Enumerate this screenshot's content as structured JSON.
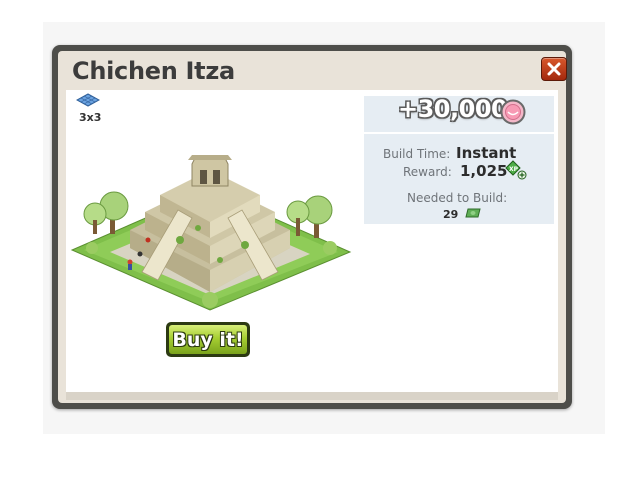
{
  "dialog": {
    "title": "Chichen Itza",
    "close_icon": "close-x-icon",
    "accent_color": "#c0401a"
  },
  "item": {
    "size_label": "3x3",
    "size_icon": "tile-footprint-icon",
    "image": "chichen-itza-pyramid"
  },
  "price": {
    "value": "+30,000",
    "currency_icon": "coin-icon"
  },
  "stats": {
    "build_time_label": "Build Time:",
    "build_time_value": "Instant",
    "reward_label": "Reward:",
    "reward_value": "1,025",
    "reward_icon": "xp-icon",
    "needed_label": "Needed to Build:",
    "needed_value": "29",
    "needed_icon": "cash-icon"
  },
  "actions": {
    "buy_label": "Buy it!"
  }
}
